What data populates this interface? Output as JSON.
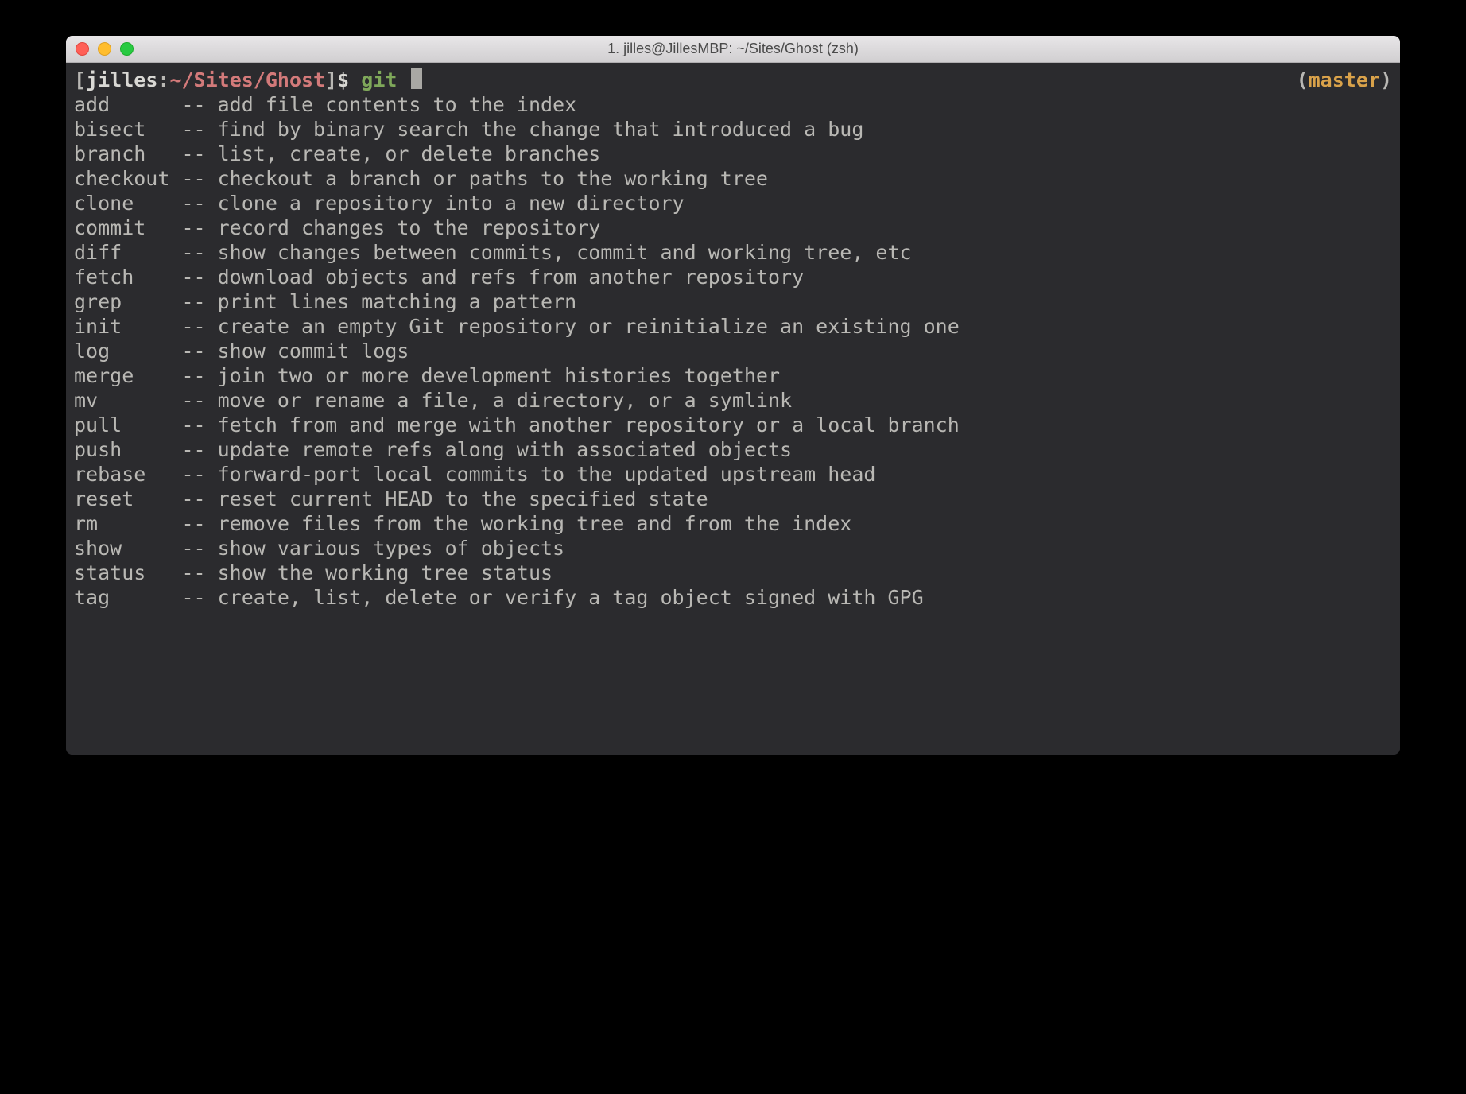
{
  "window": {
    "title": "1. jilles@JillesMBP: ~/Sites/Ghost (zsh)"
  },
  "prompt": {
    "open_bracket": "[",
    "user": "jilles",
    "colon": ":",
    "path": "~/Sites/Ghost",
    "close_bracket": "]",
    "dollar": "$ ",
    "command": "git ",
    "branch_open": "(",
    "branch": "master",
    "branch_close": ")"
  },
  "completions": [
    {
      "cmd": "add",
      "desc": "add file contents to the index"
    },
    {
      "cmd": "bisect",
      "desc": "find by binary search the change that introduced a bug"
    },
    {
      "cmd": "branch",
      "desc": "list, create, or delete branches"
    },
    {
      "cmd": "checkout",
      "desc": "checkout a branch or paths to the working tree"
    },
    {
      "cmd": "clone",
      "desc": "clone a repository into a new directory"
    },
    {
      "cmd": "commit",
      "desc": "record changes to the repository"
    },
    {
      "cmd": "diff",
      "desc": "show changes between commits, commit and working tree, etc"
    },
    {
      "cmd": "fetch",
      "desc": "download objects and refs from another repository"
    },
    {
      "cmd": "grep",
      "desc": "print lines matching a pattern"
    },
    {
      "cmd": "init",
      "desc": "create an empty Git repository or reinitialize an existing one"
    },
    {
      "cmd": "log",
      "desc": "show commit logs"
    },
    {
      "cmd": "merge",
      "desc": "join two or more development histories together"
    },
    {
      "cmd": "mv",
      "desc": "move or rename a file, a directory, or a symlink"
    },
    {
      "cmd": "pull",
      "desc": "fetch from and merge with another repository or a local branch"
    },
    {
      "cmd": "push",
      "desc": "update remote refs along with associated objects"
    },
    {
      "cmd": "rebase",
      "desc": "forward-port local commits to the updated upstream head"
    },
    {
      "cmd": "reset",
      "desc": "reset current HEAD to the specified state"
    },
    {
      "cmd": "rm",
      "desc": "remove files from the working tree and from the index"
    },
    {
      "cmd": "show",
      "desc": "show various types of objects"
    },
    {
      "cmd": "status",
      "desc": "show the working tree status"
    },
    {
      "cmd": "tag",
      "desc": "create, list, delete or verify a tag object signed with GPG"
    }
  ],
  "separator": "-- "
}
